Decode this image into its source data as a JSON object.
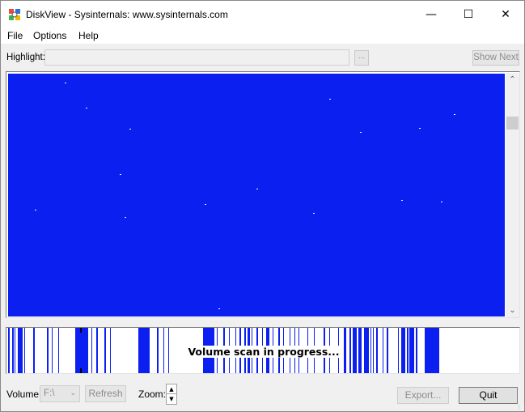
{
  "window": {
    "title": "DiskView - Sysinternals: www.sysinternals.com",
    "minimize_glyph": "—",
    "maximize_glyph": "☐",
    "close_glyph": "✕"
  },
  "menu": [
    {
      "label": "File"
    },
    {
      "label": "Options"
    },
    {
      "label": "Help"
    }
  ],
  "highlight": {
    "label": "Highlight:",
    "value": "",
    "browse_label": "...",
    "show_next_label": "Show Next"
  },
  "map": {
    "color": "#0b1ff0"
  },
  "overview": {
    "status_text": "Volume scan in progress...",
    "bar_color": "#0b1ff0"
  },
  "bottom": {
    "volume_label": "Volume:",
    "volume_value": "F:\\",
    "refresh_label": "Refresh",
    "zoom_label": "Zoom:",
    "export_label": "Export...",
    "quit_label": "Quit"
  }
}
